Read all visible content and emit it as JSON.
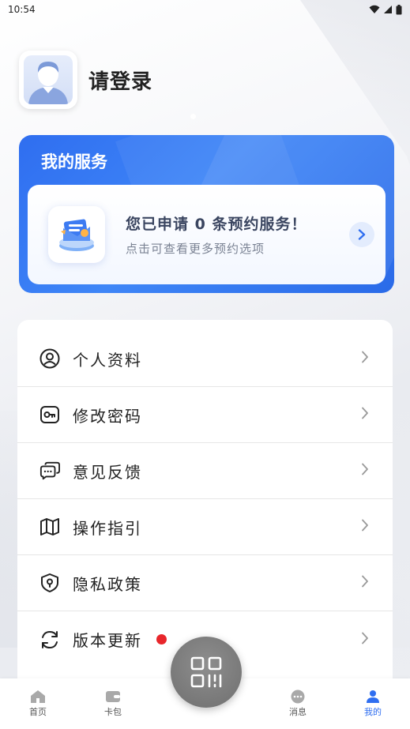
{
  "status_bar": {
    "time": "10:54"
  },
  "profile": {
    "login_text": "请登录"
  },
  "service": {
    "title": "我的服务",
    "headline": "您已申请 0 条预约服务！",
    "subtitle": "点击可查看更多预约选项"
  },
  "menu": {
    "items": [
      {
        "label": "个人资料",
        "icon": "user-circle-icon"
      },
      {
        "label": "修改密码",
        "icon": "key-icon"
      },
      {
        "label": "意见反馈",
        "icon": "chat-bubbles-icon"
      },
      {
        "label": "操作指引",
        "icon": "map-icon"
      },
      {
        "label": "隐私政策",
        "icon": "shield-location-icon"
      },
      {
        "label": "版本更新",
        "icon": "refresh-icon",
        "badge": "red-dot"
      }
    ]
  },
  "bottom_nav": {
    "items": [
      {
        "label": "首页",
        "icon": "home-icon"
      },
      {
        "label": "卡包",
        "icon": "wallet-icon"
      },
      {
        "label": "消息",
        "icon": "message-icon"
      },
      {
        "label": "我的",
        "icon": "person-icon",
        "active": true
      }
    ]
  },
  "colors": {
    "accent": "#2f6ef0",
    "badge": "#e8262b",
    "scan_button": "#777777"
  }
}
